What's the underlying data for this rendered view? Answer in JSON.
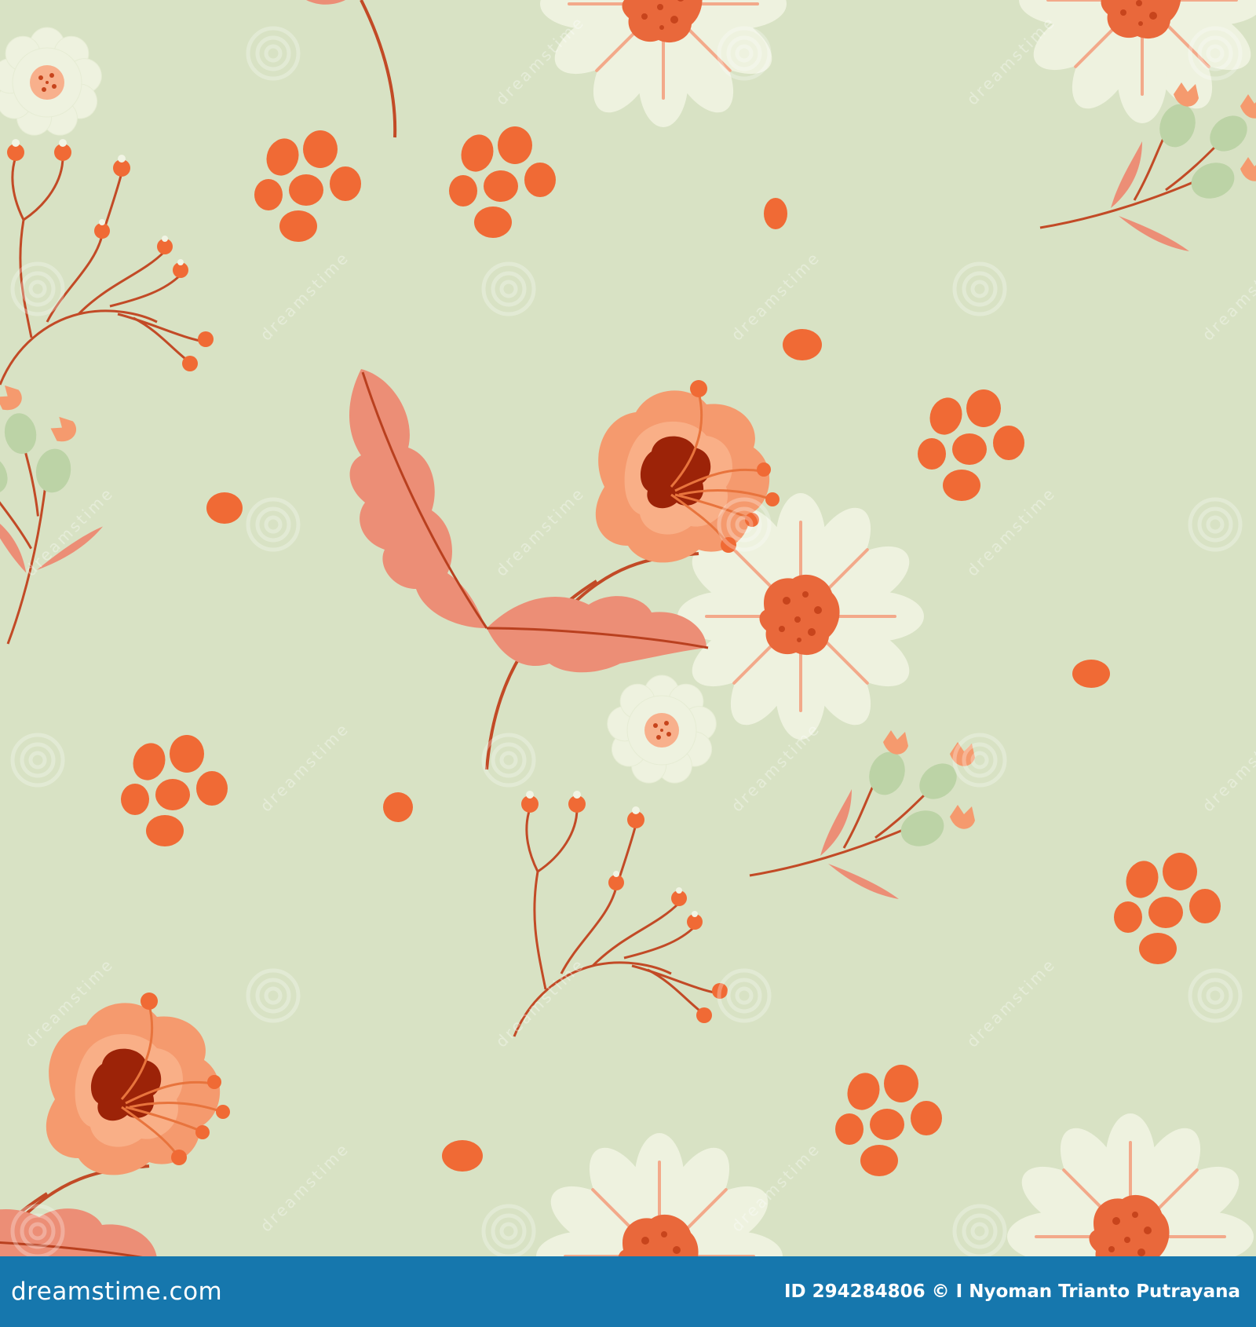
{
  "image": {
    "background_color": "#d8e2c4",
    "footer_color": "#1677ad",
    "palette": {
      "poppy": "#f59a6e",
      "poppy_light": "#fbb891",
      "poppy_center": "#9c2308",
      "leaf": "#ec8e76",
      "leaf_vein": "#b9401f",
      "stem": "#c24a26",
      "dot": "#f06a35",
      "daisy_petal": "#eef2df",
      "daisy_center": "#e9683b",
      "green_bud": "#bcd3a6"
    },
    "watermark": {
      "text": "dreamstime"
    },
    "footer": {
      "logo": "dreamstime.com",
      "credit": "ID 294284806 © I Nyoman Trianto Putrayana"
    }
  }
}
